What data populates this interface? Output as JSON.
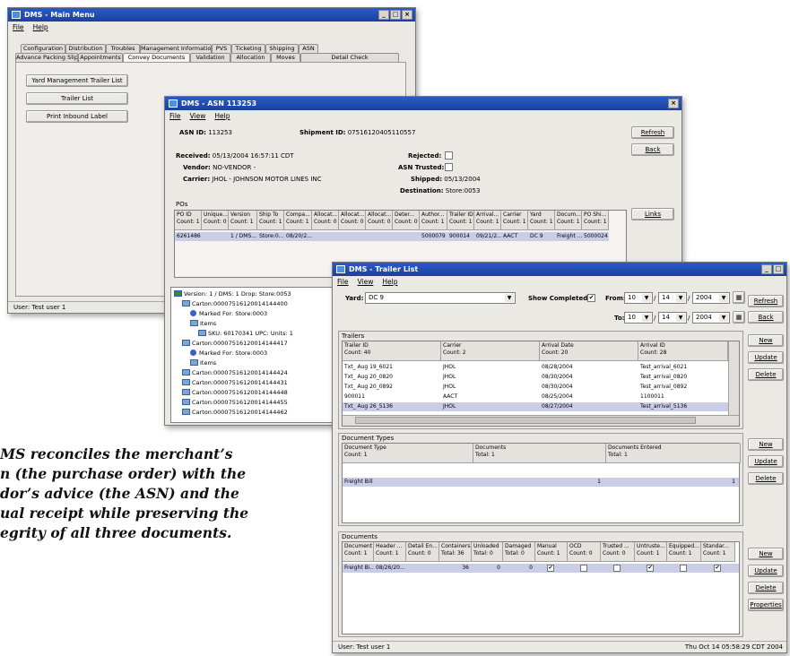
{
  "main_window": {
    "title": "DMS - Main Menu",
    "menu": [
      "File",
      "Help"
    ],
    "tabs_row1": [
      "Configuration",
      "Distribution",
      "Troubles",
      "Management Information",
      "PVS",
      "Ticketing",
      "Shipping",
      "ASN"
    ],
    "tabs_row2": [
      "Advance Packing Slips",
      "Appointments",
      "Convey Documents",
      "Validation",
      "Allocation",
      "Moves",
      "Detail Check"
    ],
    "buttons": [
      "Yard Management Trailer List",
      "Trailer List",
      "Print Inbound Label"
    ],
    "status_user": "User:  Test user 1"
  },
  "asn_window": {
    "title": "DMS - ASN 113253",
    "menu": [
      "File",
      "View",
      "Help"
    ],
    "asn_id_label": "ASN ID:",
    "asn_id": "113253",
    "shipment_id_label": "Shipment ID:",
    "shipment_id": "07516120405110557",
    "received_label": "Received:",
    "received": "05/13/2004 16:57:11 CDT",
    "vendor_label": "Vendor:",
    "vendor": "NO-VENDOR -",
    "carrier_label": "Carrier:",
    "carrier": "JHOL - JOHNSON MOTOR LINES INC",
    "rejected_label": "Rejected:",
    "asn_trusted_label": "ASN Trusted:",
    "shipped_label": "Shipped:",
    "shipped": "05/13/2004",
    "destination_label": "Destination:",
    "destination": "Store:0053",
    "buttons": [
      "Refresh",
      "Back",
      "Links"
    ],
    "pos_label": "POs",
    "po_columns": [
      [
        "PO ID",
        "Count: 1"
      ],
      [
        "Unique...",
        "Count: 0"
      ],
      [
        "Version",
        "Count: 1"
      ],
      [
        "Ship To",
        "Count: 1"
      ],
      [
        "Compa...",
        "Count: 1"
      ],
      [
        "Allocat...",
        "Count: 0"
      ],
      [
        "Allocat...",
        "Count: 0"
      ],
      [
        "Allocat...",
        "Count: 0"
      ],
      [
        "Deter...",
        "Count: 0"
      ],
      [
        "Author...",
        "Count: 1"
      ],
      [
        "Trailer ID",
        "Count: 1"
      ],
      [
        "Arrival...",
        "Count: 1"
      ],
      [
        "Carrier",
        "Count: 1"
      ],
      [
        "Yard",
        "Count: 1"
      ],
      [
        "Docum...",
        "Count: 1"
      ],
      [
        "PO Shi...",
        "Count: 1"
      ]
    ],
    "po_row": [
      "6261486",
      "",
      "1 / DMS...",
      "Store:0...",
      "08/20/2...",
      "",
      "",
      "",
      "",
      "5000079",
      "900014",
      "09/21/2...",
      "AACT",
      "DC 9",
      "Freight ...",
      "5000024"
    ],
    "tree": [
      {
        "text": "Version: 1 / DMS: 1  Drop: Store:0053",
        "indent": 0,
        "kind": "root"
      },
      {
        "text": "Carton:00007516120014144400",
        "indent": 1,
        "kind": "folder"
      },
      {
        "text": "Marked For: Store:0003",
        "indent": 2,
        "kind": "dot"
      },
      {
        "text": "Items",
        "indent": 2,
        "kind": "folder"
      },
      {
        "text": "SKU: 60170341  UPC:   Units: 1",
        "indent": 3,
        "kind": "item"
      },
      {
        "text": "Carton:00007516120014144417",
        "indent": 1,
        "kind": "folder"
      },
      {
        "text": "Marked For: Store:0003",
        "indent": 2,
        "kind": "dot"
      },
      {
        "text": "Items",
        "indent": 2,
        "kind": "folder"
      },
      {
        "text": "Carton:00007516120014144424",
        "indent": 1,
        "kind": "folder"
      },
      {
        "text": "Carton:00007516120014144431",
        "indent": 1,
        "kind": "folder"
      },
      {
        "text": "Carton:00007516120014144448",
        "indent": 1,
        "kind": "folder"
      },
      {
        "text": "Carton:00007516120014144455",
        "indent": 1,
        "kind": "folder"
      },
      {
        "text": "Carton:00007516120014144462",
        "indent": 1,
        "kind": "folder"
      }
    ]
  },
  "trailer_window": {
    "title": "DMS - Trailer List",
    "menu": [
      "File",
      "View",
      "Help"
    ],
    "yard_label": "Yard:",
    "yard_value": "DC 9",
    "show_completed_label": "Show Completed:",
    "from_label": "From:",
    "from_month": "10",
    "from_day": "14",
    "from_year": "2004",
    "to_label": "To:",
    "to_month": "10",
    "to_day": "14",
    "to_year": "2004",
    "trailers_label": "Trailers",
    "trailer_columns": [
      [
        "Trailer ID",
        "Count: 40"
      ],
      [
        "Carrier",
        "Count: 2"
      ],
      [
        "Arrival Date",
        "Count: 20"
      ],
      [
        "Arrival ID",
        "Count: 28"
      ]
    ],
    "trailer_rows": [
      [
        "Txt_ Aug 19_6021",
        "JHOL",
        "08/28/2004",
        "Test_arrival_6021"
      ],
      [
        "Txt_ Aug 20_0820",
        "JHOL",
        "08/30/2004",
        "Test_arrival_0820"
      ],
      [
        "Txt_ Aug 20_0892",
        "JHOL",
        "08/30/2004",
        "Test_arrival_0892"
      ],
      [
        "900011",
        "AACT",
        "08/25/2004",
        "1100011"
      ],
      [
        "Txt_ Aug 26_5136",
        "JHOL",
        "08/27/2004",
        "Test_arrival_5136"
      ]
    ],
    "doc_types_label": "Document Types",
    "doc_type_columns": [
      [
        "Document Type",
        "Count: 1"
      ],
      [
        "Documents",
        "Total: 1"
      ],
      [
        "Documents Entered",
        "Total: 1"
      ]
    ],
    "doc_type_row": [
      "Freight Bill",
      "1",
      "1"
    ],
    "documents_label": "Documents",
    "doc_columns": [
      [
        "Document",
        "Count: 1"
      ],
      [
        "Header ...",
        "Count: 1"
      ],
      [
        "Detail En...",
        "Count: 0"
      ],
      [
        "Containers",
        "Total: 36"
      ],
      [
        "Unloaded",
        "Total: 0"
      ],
      [
        "Damaged",
        "Total: 0"
      ],
      [
        "Manual",
        "Count: 1"
      ],
      [
        "OCD",
        "Count: 0"
      ],
      [
        "Trusted ...",
        "Count: 0"
      ],
      [
        "Untruste...",
        "Count: 1"
      ],
      [
        "Equipped...",
        "Count: 1"
      ],
      [
        "Standar...",
        "Count: 1"
      ]
    ],
    "doc_row": [
      "Freight Bi...",
      "08/26/20...",
      "",
      "36",
      "0",
      "0"
    ],
    "buttons": [
      "Refresh",
      "Back",
      "New",
      "Update",
      "Delete",
      "New",
      "Update",
      "Delete",
      "New",
      "Update",
      "Delete",
      "Properties"
    ],
    "status_user": "User:  Test user 1",
    "status_time": "Thu Oct 14 05:58:29 CDT 2004"
  },
  "caption_lines": [
    "MS reconciles the merchant’s",
    "n (the purchase order) with the",
    "dor’s advice (the ASN) and the",
    "ual receipt while preserving the",
    "egrity of all three documents."
  ],
  "colors": {
    "titlebar": "#1c3f9e",
    "selection": "#c9cde8",
    "window_bg": "#ebe9e4"
  }
}
